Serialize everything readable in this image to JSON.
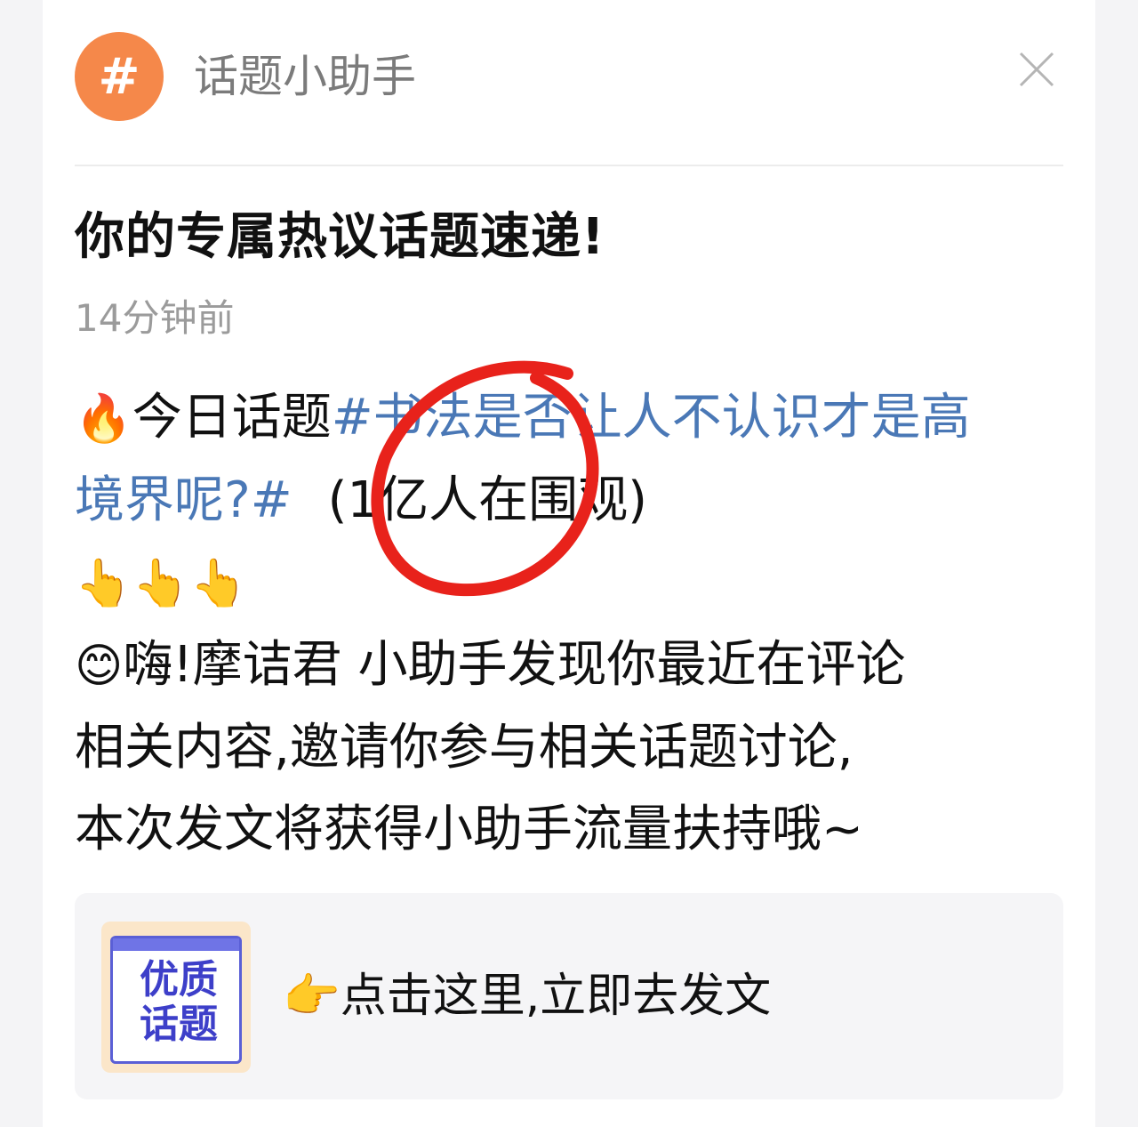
{
  "header": {
    "avatar_symbol": "#",
    "title": "话题小助手",
    "close_icon": "close-icon"
  },
  "message": {
    "title": "你的专属热议话题速递!",
    "time": "14分钟前",
    "topic_prefix_emoji": "🔥",
    "topic_prefix": "今日话题",
    "topic_line1": "#书法是否让人不认识才是高",
    "topic_line2": "境界呢?#",
    "topic_views": "(1亿人在围观)",
    "pointing_emojis": "👆👆👆",
    "greeting_emoji": "😊",
    "body_line1": "嗨!摩诘君 小助手发现你最近在评论",
    "body_line2": "相关内容,邀请你参与相关话题讨论,",
    "body_line3": "本次发文将获得小助手流量扶持哦~"
  },
  "post": {
    "thumb_text_line1": "优质",
    "thumb_text_line2": "话题",
    "action_emoji": "👉",
    "action_label": "点击这里,立即去发文"
  },
  "colors": {
    "avatar": "#f5884a",
    "link": "#4a78b6",
    "annotation_circle": "#e8221b"
  }
}
